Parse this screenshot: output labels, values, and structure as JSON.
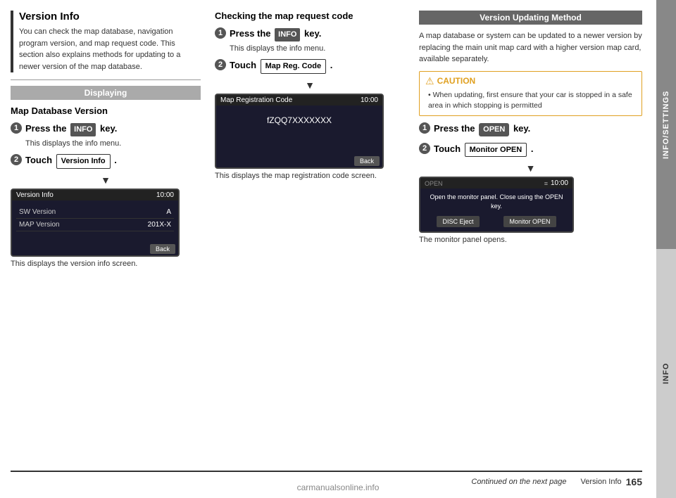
{
  "page": {
    "title": "Version Info",
    "page_number": "165",
    "page_label": "Version Info",
    "continued_text": "Continued on the next page",
    "watermark": "carmanualsonline.info"
  },
  "tabs": {
    "info_settings": "INFO/SETTINGS",
    "info": "INFO"
  },
  "version_info_section": {
    "title": "Version Info",
    "description": "You can check the map database, navigation program version, and map request code. This section also explains methods for updating to a newer version of the map database."
  },
  "displaying_section": {
    "header": "Displaying",
    "map_database_title": "Map Database Version",
    "step1_main": "Press the  INFO  key.",
    "step1_sub": "This displays the info menu.",
    "step2_main": "Touch  Version Info  .",
    "screen1_title": "Version Info",
    "screen1_time": "10:00",
    "screen1_row1_label": "SW Version",
    "screen1_row1_value": "A",
    "screen1_row2_label": "MAP Version",
    "screen1_row2_value": "201X-X",
    "screen1_back": "Back",
    "screen1_caption": "This displays the version info screen."
  },
  "checking_section": {
    "title": "Checking the map request code",
    "step1_main": "Press the  INFO  key.",
    "step1_sub": "This displays the info menu.",
    "step2_main": "Touch  Map Reg. Code  .",
    "screen2_title": "Map Registration Code",
    "screen2_time": "10:00",
    "screen2_code": "fZQQ7XXXXXXX",
    "screen2_back": "Back",
    "screen2_caption": "This displays the map registration code screen."
  },
  "version_updating_section": {
    "header": "Version Updating Method",
    "description": "A map database or system can be updated to a newer version by replacing the main unit map card with a higher version map card, available separately.",
    "caution_title": "CAUTION",
    "caution_text": "When updating, first ensure that your car is stopped in a safe area in which stopping is permitted",
    "step1_main": "Press the  OPEN  key.",
    "step2_main": "Touch  Monitor OPEN  .",
    "monitor_screen_time": "10:00",
    "monitor_open_label": "OPEN",
    "monitor_prompt": "Open the monitor panel. Close using the OPEN key.",
    "monitor_btn1": "DISC Eject",
    "monitor_btn2": "Monitor OPEN",
    "monitor_caption": "The monitor panel opens."
  }
}
